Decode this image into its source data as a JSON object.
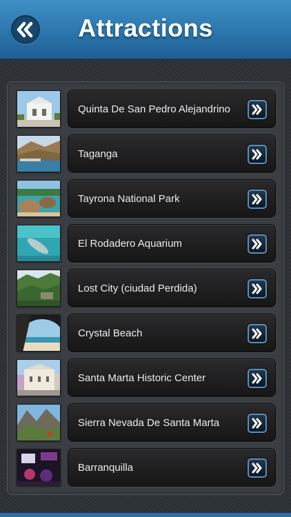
{
  "header": {
    "title": "Attractions",
    "back_icon": "double-chevron-left-icon",
    "color": "#2f7db5"
  },
  "list": {
    "arrow_icon": "double-chevron-right-icon",
    "items": [
      {
        "label": "Quinta De San Pedro Alejandrino",
        "thumbnail": "white-colonial-building-photo"
      },
      {
        "label": "Taganga",
        "thumbnail": "coastal-bay-village-photo"
      },
      {
        "label": "Tayrona National Park",
        "thumbnail": "beach-rocks-photo"
      },
      {
        "label": "El Rodadero Aquarium",
        "thumbnail": "dolphin-in-water-photo"
      },
      {
        "label": "Lost City (ciudad Perdida)",
        "thumbnail": "jungle-ruins-photo"
      },
      {
        "label": "Crystal Beach",
        "thumbnail": "beach-cave-photo"
      },
      {
        "label": "Santa Marta Historic Center",
        "thumbnail": "historic-building-photo"
      },
      {
        "label": "Sierra Nevada De Santa Marta",
        "thumbnail": "mountain-valley-photo"
      },
      {
        "label": "Barranquilla",
        "thumbnail": "carnival-night-photo"
      }
    ]
  }
}
